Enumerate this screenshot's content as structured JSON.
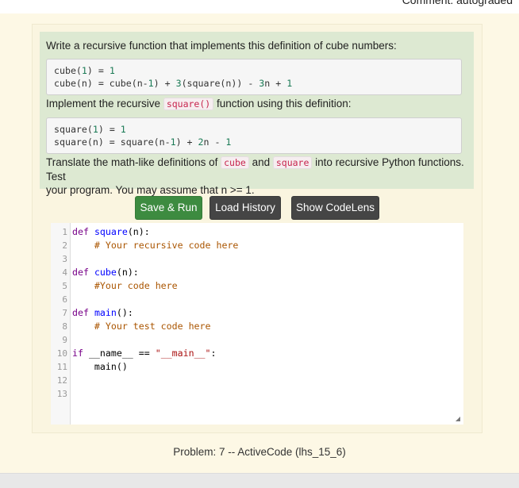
{
  "header": {
    "comment": "Comment: autograded"
  },
  "description": {
    "intro": "Write a recursive function that implements this definition of cube numbers:",
    "cube_def": {
      "line1": {
        "pre": "cube(",
        "n1": "1",
        "mid": ") = ",
        "n2": "1"
      },
      "line2": {
        "pre": "cube(n) = cube(n-",
        "n1": "1",
        "mid": ") + ",
        "n2": "3",
        "mid2": "(square(n)) - ",
        "n3": "3",
        "mid3": "n + ",
        "n4": "1"
      }
    },
    "implement_pre": "Implement the recursive ",
    "implement_code": "square()",
    "implement_post": " function using this definition:",
    "square_def": {
      "line1": {
        "pre": "square(",
        "n1": "1",
        "mid": ") = ",
        "n2": "1"
      },
      "line2": {
        "pre": "square(n) = square(n-",
        "n1": "1",
        "mid": ") + ",
        "n2": "2",
        "mid2": "n - ",
        "n3": "1"
      }
    },
    "translate_pre": "Translate the math-like definitions of ",
    "translate_code1": "cube",
    "translate_and": " and ",
    "translate_code2": "square",
    "translate_post": " into recursive Python functions. Test",
    "translate_line2": "your program. You may assume that n >= 1."
  },
  "toolbar": {
    "save_run": "Save & Run",
    "load_history": "Load History",
    "show_codelens": "Show CodeLens"
  },
  "editor": {
    "line_numbers": [
      "1",
      "2",
      "3",
      "4",
      "5",
      "6",
      "7",
      "8",
      "9",
      "10",
      "11",
      "12",
      "13"
    ],
    "code": {
      "l1_kw": "def",
      "l1_fn": "square",
      "l1_rest": "(n):",
      "l2_cmt": "    # Your recursive code here",
      "l4_kw": "def",
      "l4_fn": "cube",
      "l4_rest": "(n):",
      "l5_cmt": "    #Your code here",
      "l7_kw": "def",
      "l7_fn": "main",
      "l7_rest": "():",
      "l8_cmt": "    # Your test code here",
      "l10_kw": "if",
      "l10_mid": " __name__ == ",
      "l10_str": "\"__main__\"",
      "l10_end": ":",
      "l11": "    main()"
    }
  },
  "caption": "Problem: 7 -- ActiveCode (lhs_15_6)"
}
